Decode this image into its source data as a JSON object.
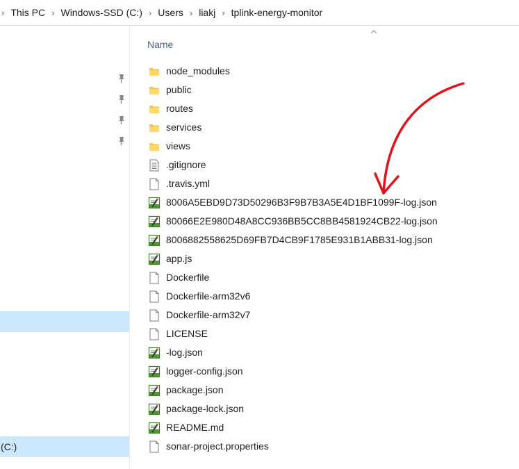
{
  "breadcrumb": [
    "This PC",
    "Windows-SSD (C:)",
    "Users",
    "liakj",
    "tplink-energy-monitor"
  ],
  "column_header": "Name",
  "nav": {
    "selected_drive_label": "(C:)"
  },
  "files": [
    {
      "name": "node_modules",
      "icon": "folder-icon"
    },
    {
      "name": "public",
      "icon": "folder-icon"
    },
    {
      "name": "routes",
      "icon": "folder-icon"
    },
    {
      "name": "services",
      "icon": "folder-icon"
    },
    {
      "name": "views",
      "icon": "folder-icon"
    },
    {
      "name": ".gitignore",
      "icon": "text-file-icon"
    },
    {
      "name": ".travis.yml",
      "icon": "blank-file-icon"
    },
    {
      "name": "8006A5EBD9D73D50296B3F9B7B3A5E4D1BF1099F-log.json",
      "icon": "notepad-file-icon"
    },
    {
      "name": "80066E2E980D48A8CC936BB5CC8BB4581924CB22-log.json",
      "icon": "notepad-file-icon"
    },
    {
      "name": "8006882558625D69FB7D4CB9F1785E931B1ABB31-log.json",
      "icon": "notepad-file-icon"
    },
    {
      "name": "app.js",
      "icon": "notepad-file-icon"
    },
    {
      "name": "Dockerfile",
      "icon": "blank-file-icon"
    },
    {
      "name": "Dockerfile-arm32v6",
      "icon": "blank-file-icon"
    },
    {
      "name": "Dockerfile-arm32v7",
      "icon": "blank-file-icon"
    },
    {
      "name": "LICENSE",
      "icon": "blank-file-icon"
    },
    {
      "name": "-log.json",
      "icon": "notepad-file-icon"
    },
    {
      "name": "logger-config.json",
      "icon": "notepad-file-icon"
    },
    {
      "name": "package.json",
      "icon": "notepad-file-icon"
    },
    {
      "name": "package-lock.json",
      "icon": "notepad-file-icon"
    },
    {
      "name": "README.md",
      "icon": "notepad-file-icon"
    },
    {
      "name": "sonar-project.properties",
      "icon": "blank-file-icon"
    }
  ],
  "colors": {
    "selection": "#cce8ff",
    "folder": "#f3c64b",
    "annotation_arrow": "#e0141e",
    "header_text": "#4c607a"
  }
}
